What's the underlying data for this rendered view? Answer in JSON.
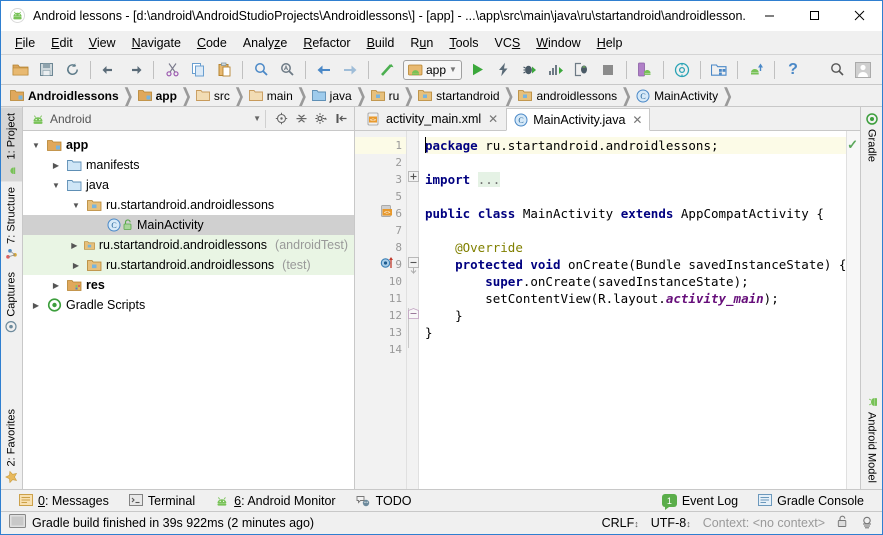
{
  "window": {
    "title": "Android lessons - [d:\\android\\AndroidStudioProjects\\Androidlessons\\] - [app] - ...\\app\\src\\main\\java\\ru\\startandroid\\androidlesson...",
    "icon": "android-studio-icon",
    "minimize": "—",
    "maximize": "☐",
    "close": "✕"
  },
  "menubar": {
    "items": [
      {
        "label": "File",
        "mnemonic": "F"
      },
      {
        "label": "Edit",
        "mnemonic": "E"
      },
      {
        "label": "View",
        "mnemonic": "V"
      },
      {
        "label": "Navigate",
        "mnemonic": "N"
      },
      {
        "label": "Code",
        "mnemonic": "C"
      },
      {
        "label": "Analyze",
        "mnemonic": "z"
      },
      {
        "label": "Refactor",
        "mnemonic": "R"
      },
      {
        "label": "Build",
        "mnemonic": "B"
      },
      {
        "label": "Run",
        "mnemonic": "u"
      },
      {
        "label": "Tools",
        "mnemonic": "T"
      },
      {
        "label": "VCS",
        "mnemonic": "S"
      },
      {
        "label": "Window",
        "mnemonic": "W"
      },
      {
        "label": "Help",
        "mnemonic": "H"
      }
    ]
  },
  "toolbar": {
    "buttons": [
      "open-folder-icon",
      "save-all-icon",
      "sync-project-icon",
      "undo-icon",
      "redo-icon",
      "cut-icon",
      "copy-icon",
      "paste-icon",
      "find-icon",
      "find-replace-icon",
      "back-icon",
      "forward-icon",
      "build-icon"
    ],
    "run_config": {
      "label": "app",
      "icon": "android-module-icon",
      "dropdown": "▾"
    },
    "right_buttons": [
      "run-icon",
      "apply-changes-icon",
      "debug-icon",
      "profile-icon",
      "attach-debugger-icon",
      "stop-icon",
      "avd-manager-icon",
      "sdk-manager-icon",
      "project-structure-icon",
      "sync-gradle-icon",
      "help-icon"
    ],
    "search_icon": "search-everywhere-icon",
    "user_icon": "user-avatar-icon"
  },
  "breadcrumb": {
    "items": [
      {
        "label": "Androidlessons",
        "icon": "module-folder-icon",
        "bold": true
      },
      {
        "label": "app",
        "icon": "module-folder-icon",
        "bold": true
      },
      {
        "label": "src",
        "icon": "folder-icon",
        "bold": false
      },
      {
        "label": "main",
        "icon": "folder-icon",
        "bold": false
      },
      {
        "label": "java",
        "icon": "source-folder-icon",
        "bold": false
      },
      {
        "label": "ru",
        "icon": "package-folder-icon",
        "bold": false
      },
      {
        "label": "startandroid",
        "icon": "package-folder-icon",
        "bold": false
      },
      {
        "label": "androidlessons",
        "icon": "package-folder-icon",
        "bold": false
      },
      {
        "label": "MainActivity",
        "icon": "java-class-icon",
        "bold": false
      }
    ],
    "separator": "❯"
  },
  "left_strip": {
    "tabs": [
      {
        "label": "1: Project",
        "mnemonic": "1",
        "icon": "project-icon",
        "active": true
      },
      {
        "label": "7: Structure",
        "mnemonic": "7",
        "icon": "structure-icon",
        "active": false
      },
      {
        "label": "Captures",
        "icon": "captures-icon",
        "active": false
      }
    ],
    "bottom_tabs": [
      {
        "label": "2: Favorites",
        "mnemonic": "2",
        "icon": "star-icon",
        "active": false
      }
    ]
  },
  "right_strip": {
    "top_tabs": [
      {
        "label": "Gradle",
        "icon": "gradle-icon",
        "active": false
      }
    ],
    "bottom_tabs": [
      {
        "label": "Android Model",
        "icon": "android-icon",
        "active": false
      }
    ]
  },
  "project_panel": {
    "view_selector": {
      "label": "Android",
      "icon": "android-icon",
      "dropdown": "▾"
    },
    "header_buttons": [
      "locate-icon",
      "collapse-all-icon",
      "settings-icon",
      "hide-icon"
    ],
    "tree": [
      {
        "depth": 0,
        "twist": "▼",
        "icon": "module-folder-icon",
        "label": "app",
        "suffix": "",
        "bold": true,
        "state": "normal"
      },
      {
        "depth": 1,
        "twist": "▶",
        "icon": "folder-icon",
        "label": "manifests",
        "suffix": "",
        "bold": false,
        "state": "normal"
      },
      {
        "depth": 1,
        "twist": "▼",
        "icon": "folder-icon",
        "label": "java",
        "suffix": "",
        "bold": false,
        "state": "normal"
      },
      {
        "depth": 2,
        "twist": "▼",
        "icon": "package-folder-icon",
        "label": "ru.startandroid.androidlessons",
        "suffix": "",
        "bold": false,
        "state": "normal"
      },
      {
        "depth": 3,
        "twist": "",
        "icon": "java-class-icon",
        "label": "MainActivity",
        "suffix": "",
        "bold": false,
        "state": "selected"
      },
      {
        "depth": 2,
        "twist": "▶",
        "icon": "package-folder-icon",
        "label": "ru.startandroid.androidlessons",
        "suffix": "(androidTest)",
        "bold": false,
        "state": "testsrc"
      },
      {
        "depth": 2,
        "twist": "▶",
        "icon": "package-folder-icon",
        "label": "ru.startandroid.androidlessons",
        "suffix": "(test)",
        "bold": false,
        "state": "testsrc"
      },
      {
        "depth": 1,
        "twist": "▶",
        "icon": "res-folder-icon",
        "label": "res",
        "suffix": "",
        "bold": true,
        "state": "normal"
      },
      {
        "depth": 0,
        "twist": "▶",
        "icon": "gradle-icon",
        "label": "Gradle Scripts",
        "suffix": "",
        "bold": false,
        "state": "normal"
      }
    ]
  },
  "editor": {
    "tabs": [
      {
        "label": "activity_main.xml",
        "icon": "xml-layout-icon",
        "active": false,
        "close": "✕"
      },
      {
        "label": "MainActivity.java",
        "icon": "java-class-icon",
        "active": true,
        "close": "✕"
      }
    ],
    "line_numbers": [
      "1",
      "2",
      "3",
      "5",
      "6",
      "7",
      "8",
      "9",
      "10",
      "11",
      "12",
      "13",
      "14"
    ],
    "lines": [
      {
        "n": "1",
        "text": "package ru.startandroid.androidlessons;",
        "highlight": true
      },
      {
        "n": "2",
        "text": "",
        "highlight": false
      },
      {
        "n": "3",
        "text": "import ...",
        "highlight": false
      },
      {
        "n": "5",
        "text": "",
        "highlight": false
      },
      {
        "n": "6",
        "text": "public class MainActivity extends AppCompatActivity {",
        "highlight": false
      },
      {
        "n": "7",
        "text": "",
        "highlight": false
      },
      {
        "n": "8",
        "text": "    @Override",
        "highlight": false
      },
      {
        "n": "9",
        "text": "    protected void onCreate(Bundle savedInstanceState) {",
        "highlight": false
      },
      {
        "n": "10",
        "text": "        super.onCreate(savedInstanceState);",
        "highlight": false
      },
      {
        "n": "11",
        "text": "        setContentView(R.layout.activity_main);",
        "highlight": false
      },
      {
        "n": "12",
        "text": "    }",
        "highlight": false
      },
      {
        "n": "13",
        "text": "}",
        "highlight": false
      },
      {
        "n": "14",
        "text": "",
        "highlight": false
      }
    ],
    "gutter_icons": [
      {
        "line": "6",
        "icon": "related-layout-icon"
      },
      {
        "line": "9",
        "icon": "overriding-method-icon"
      }
    ],
    "fold_markers": [
      {
        "line": "3",
        "glyph": "+"
      },
      {
        "line": "9",
        "glyph": "−"
      },
      {
        "line": "12",
        "glyph": "−"
      }
    ],
    "inspection_status": "ok-check-icon"
  },
  "toolwindow_bar": {
    "left_items": [
      {
        "label": "0: Messages",
        "mnemonic": "0",
        "icon": "messages-icon"
      },
      {
        "label": "Terminal",
        "icon": "terminal-icon"
      },
      {
        "label": "6: Android Monitor",
        "mnemonic": "6",
        "icon": "android-icon"
      },
      {
        "label": "TODO",
        "icon": "todo-icon"
      }
    ],
    "right_items": [
      {
        "label": "Event Log",
        "icon": "event-log-icon",
        "badge": "1"
      },
      {
        "label": "Gradle Console",
        "icon": "gradle-console-icon"
      }
    ]
  },
  "statusbar": {
    "icon": "status-toggle-icon",
    "message": "Gradle build finished in 39s 922ms (2 minutes ago)",
    "line_separator": "CRLF",
    "encoding": "UTF-8",
    "context": "Context: <no context>",
    "lock_icon": "unlock-icon",
    "inspections_icon": "inspections-icon",
    "stepper": "↕"
  },
  "colors": {
    "accent": "#2f7fd0",
    "window_bg": "#f0f0f0",
    "editor_bg": "#ffffff",
    "selection": "#d0d0d0",
    "test_source": "#e9f5e4",
    "caret_line": "#fcfbe7",
    "keyword": "#000080",
    "annotation": "#808000",
    "field": "#660e7a",
    "android_green": "#78c257",
    "folder_tan": "#c79a5b"
  }
}
